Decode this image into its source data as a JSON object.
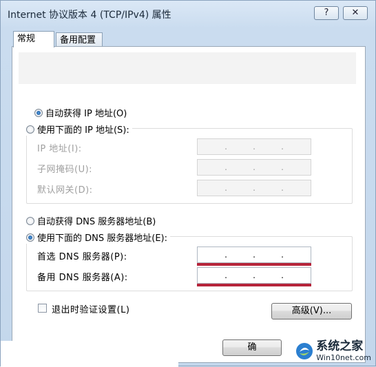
{
  "window": {
    "title": "Internet 协议版本 4 (TCP/IPv4) 属性",
    "help_glyph": "?",
    "close_glyph": "✕"
  },
  "tabs": [
    {
      "label": "常规",
      "active": true
    },
    {
      "label": "备用配置",
      "active": false
    }
  ],
  "ip_section": {
    "auto_ip_label": "自动获得 IP 地址(O)",
    "auto_ip_selected": true,
    "manual_ip_label": "使用下面的 IP 地址(S):",
    "manual_ip_selected": false,
    "fields": [
      {
        "label": "IP 地址(I):",
        "value": ". . ."
      },
      {
        "label": "子网掩码(U):",
        "value": ". . ."
      },
      {
        "label": "默认网关(D):",
        "value": ". . ."
      }
    ]
  },
  "dns_section": {
    "auto_dns_label": "自动获得 DNS 服务器地址(B)",
    "auto_dns_selected": false,
    "manual_dns_label": "使用下面的 DNS 服务器地址(E):",
    "manual_dns_selected": true,
    "fields": [
      {
        "label": "首选 DNS 服务器(P):"
      },
      {
        "label": "备用 DNS 服务器(A):"
      }
    ]
  },
  "validate_on_exit": {
    "label": "退出时验证设置(L)",
    "checked": false
  },
  "buttons": {
    "advanced": "高级(V)...",
    "ok_partial": "确"
  },
  "watermark": {
    "title": "系统之家",
    "url": "Win10net.com"
  },
  "colors": {
    "highlight_underline": "#b6243a",
    "window_bg": "#cadcef"
  }
}
